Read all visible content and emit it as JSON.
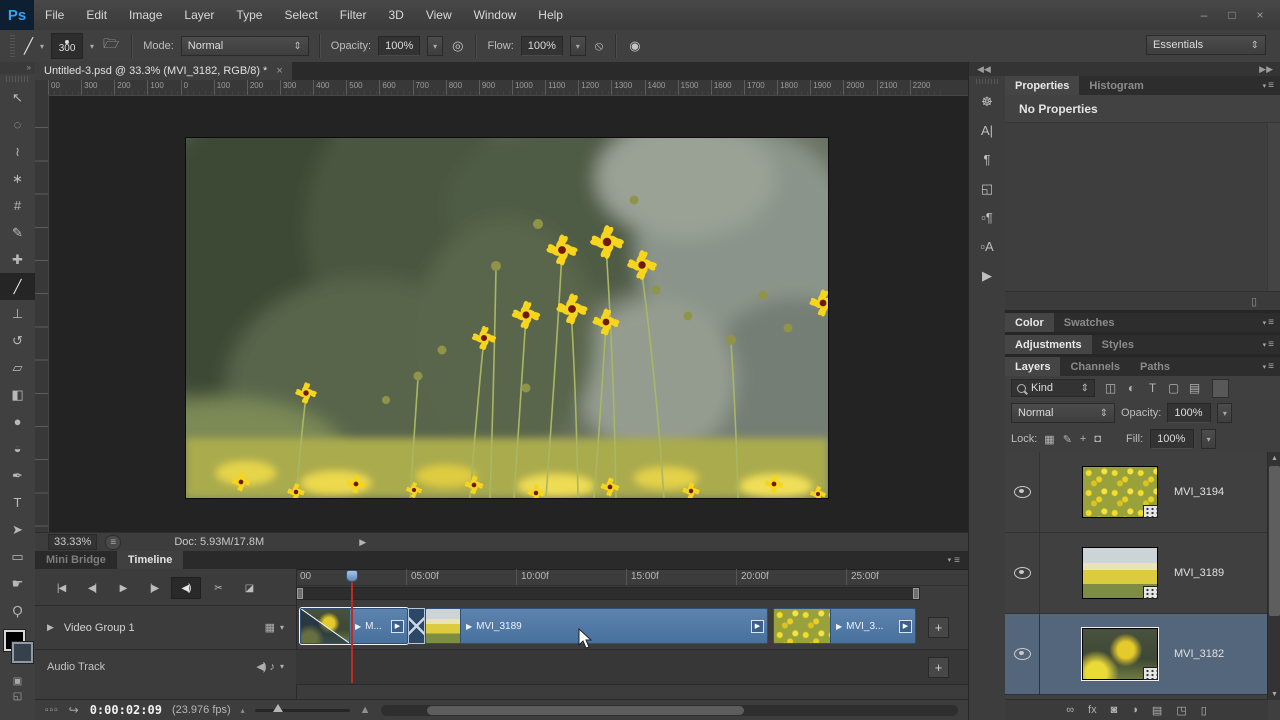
{
  "window": {
    "controls": [
      {
        "name": "minimize-button",
        "glyph": "–"
      },
      {
        "name": "maximize-button",
        "glyph": "□"
      },
      {
        "name": "close-button",
        "glyph": "×"
      }
    ]
  },
  "menu": {
    "logo": "Ps",
    "items": [
      "File",
      "Edit",
      "Image",
      "Layer",
      "Type",
      "Select",
      "Filter",
      "3D",
      "View",
      "Window",
      "Help"
    ]
  },
  "options": {
    "brush_glyph": "╱",
    "brush_size": "300",
    "mode_label": "Mode:",
    "mode_value": "Normal",
    "opacity_label": "Opacity:",
    "opacity_value": "100%",
    "flow_label": "Flow:",
    "flow_value": "100%",
    "workspace": "Essentials",
    "spinner_glyph": "⇕",
    "dropdown_glyph": "▾"
  },
  "tools": [
    {
      "name": "move-tool",
      "glyph": "↖"
    },
    {
      "name": "marquee-tool",
      "glyph": "◌"
    },
    {
      "name": "lasso-tool",
      "glyph": "≀"
    },
    {
      "name": "magic-wand-tool",
      "glyph": "∗"
    },
    {
      "name": "crop-tool",
      "glyph": "#"
    },
    {
      "name": "eyedropper-tool",
      "glyph": "✎"
    },
    {
      "name": "healing-brush-tool",
      "glyph": "✚"
    },
    {
      "name": "brush-tool",
      "glyph": "╱",
      "cls": "active"
    },
    {
      "name": "clone-stamp-tool",
      "glyph": "⊥"
    },
    {
      "name": "history-brush-tool",
      "glyph": "↺"
    },
    {
      "name": "eraser-tool",
      "glyph": "▱"
    },
    {
      "name": "gradient-tool",
      "glyph": "◧"
    },
    {
      "name": "blur-tool",
      "glyph": "●"
    },
    {
      "name": "dodge-tool",
      "glyph": "◒"
    },
    {
      "name": "pen-tool",
      "glyph": "✒"
    },
    {
      "name": "type-tool",
      "glyph": "T"
    },
    {
      "name": "path-selection-tool",
      "glyph": "➤"
    },
    {
      "name": "shape-tool",
      "glyph": "▭"
    },
    {
      "name": "hand-tool",
      "glyph": "☛"
    },
    {
      "name": "zoom-tool",
      "glyph": "Ϙ"
    }
  ],
  "toolbar_extra": {
    "quick_mask_glyph": "▣",
    "screen_mode_glyph": "◱",
    "swap_glyph": "⇄"
  },
  "document": {
    "tab_title": "Untitled-3.psd @ 33.3% (MVI_3182, RGB/8) *",
    "tab_close": "×",
    "ruler_ticks": [
      "00",
      "300",
      "200",
      "100",
      "0",
      "100",
      "200",
      "300",
      "400",
      "500",
      "600",
      "700",
      "800",
      "900",
      "1000",
      "1100",
      "1200",
      "1300",
      "1400",
      "1500",
      "1600",
      "1700",
      "1800",
      "1900",
      "2000",
      "2100",
      "2200"
    ],
    "zoom_level": "33.33%",
    "doc_size": "Doc: 5.93M/17.8M",
    "status_arrow": "▶"
  },
  "timeline": {
    "tabs": [
      {
        "label": "Mini Bridge",
        "cls": "inactive",
        "name": "tab-mini-bridge"
      },
      {
        "label": "Timeline",
        "cls": "active",
        "name": "tab-timeline"
      }
    ],
    "panel_menu_glyph": "≡",
    "transport": [
      {
        "name": "go-to-first-frame-button",
        "glyph": "|◀"
      },
      {
        "name": "previous-frame-button",
        "glyph": "◀|"
      },
      {
        "name": "play-button",
        "glyph": "▶"
      },
      {
        "name": "next-frame-button",
        "glyph": "|▶"
      },
      {
        "name": "mute-audio-button",
        "glyph": "◀)",
        "cls": "pressed"
      },
      {
        "name": "split-clip-button",
        "glyph": "✂"
      },
      {
        "name": "transition-button",
        "glyph": "◪"
      }
    ],
    "ruler": [
      "00",
      "05:00f",
      "10:00f",
      "15:00f",
      "20:00f",
      "25:00f"
    ],
    "video_group_label": "Video Group 1",
    "audio_track_label": "Audio Track",
    "clips": [
      {
        "label": "M..."
      },
      {
        "label": "MVI_3189"
      },
      {
        "label": "MVI_3..."
      }
    ],
    "add_track_glyph": "+",
    "frames_glyph": "▫▫▫",
    "render_glyph": "↪",
    "timecode": "0:00:02:09",
    "fps": "(23.976 fps)",
    "zoom_out_glyph": "▴",
    "zoom_in_glyph": "▲"
  },
  "panel_icons": [
    {
      "name": "adjustments-panel-icon",
      "glyph": "☸"
    },
    {
      "name": "character-panel-icon",
      "glyph": "A|"
    },
    {
      "name": "paragraph-panel-icon",
      "glyph": "¶"
    },
    {
      "name": "clone-source-panel-icon",
      "glyph": "◱"
    },
    {
      "name": "paragraph-styles-panel-icon",
      "glyph": "▫¶"
    },
    {
      "name": "character-styles-panel-icon",
      "glyph": "▫A"
    },
    {
      "name": "timeline-panel-icon",
      "glyph": "▶"
    }
  ],
  "panels": {
    "collapse_left": "◀◀",
    "collapse_right": "▶▶",
    "panel_menu_glyph": "≡",
    "properties": {
      "tabs": [
        {
          "label": "Properties",
          "cls": "active",
          "name": "tab-properties"
        },
        {
          "label": "Histogram",
          "cls": "dim",
          "name": "tab-histogram"
        }
      ],
      "message": "No Properties",
      "delete_glyph": "▯"
    },
    "color": {
      "tabs": [
        {
          "label": "Color",
          "cls": "active",
          "name": "tab-color"
        },
        {
          "label": "Swatches",
          "cls": "dim",
          "name": "tab-swatches"
        }
      ]
    },
    "adjustments": {
      "tabs": [
        {
          "label": "Adjustments",
          "cls": "active",
          "name": "tab-adjustments"
        },
        {
          "label": "Styles",
          "cls": "dim",
          "name": "tab-styles"
        }
      ]
    },
    "layers": {
      "tabs": [
        {
          "label": "Layers",
          "cls": "active",
          "name": "tab-layers"
        },
        {
          "label": "Channels",
          "cls": "dim",
          "name": "tab-channels"
        },
        {
          "label": "Paths",
          "cls": "dim",
          "name": "tab-paths"
        }
      ],
      "filter_value": "Kind",
      "filter_icons": [
        {
          "name": "filter-pixel-layers-icon",
          "glyph": "◫"
        },
        {
          "name": "filter-adjustment-layers-icon",
          "glyph": "◐"
        },
        {
          "name": "filter-type-layers-icon",
          "glyph": "T"
        },
        {
          "name": "filter-shape-layers-icon",
          "glyph": "▢"
        },
        {
          "name": "filter-smart-objects-icon",
          "glyph": "▤"
        }
      ],
      "blend_mode": "Normal",
      "opacity_label": "Opacity:",
      "opacity_value": "100%",
      "lock_label": "Lock:",
      "lock_icons": [
        {
          "name": "lock-transparency-icon",
          "glyph": "▦"
        },
        {
          "name": "lock-pixels-icon",
          "glyph": "✎"
        },
        {
          "name": "lock-position-icon",
          "glyph": "+"
        },
        {
          "name": "lock-all-icon",
          "glyph": "◘"
        }
      ],
      "fill_label": "Fill:",
      "fill_value": "100%",
      "items": [
        {
          "name": "MVI_3194",
          "cls": "thumb-3194"
        },
        {
          "name": "MVI_3189",
          "cls": "thumb-3189"
        },
        {
          "name": "MVI_3182",
          "cls": "thumb-3182 selected"
        }
      ],
      "footer_icons": [
        {
          "name": "link-layers-icon",
          "glyph": "∞"
        },
        {
          "name": "layer-effects-icon",
          "glyph": "fx"
        },
        {
          "name": "add-mask-icon",
          "glyph": "◙"
        },
        {
          "name": "adjustment-layer-icon",
          "glyph": "◑"
        },
        {
          "name": "new-group-icon",
          "glyph": "▤"
        },
        {
          "name": "new-layer-icon",
          "glyph": "◳"
        },
        {
          "name": "delete-layer-icon",
          "glyph": "▯"
        }
      ]
    }
  },
  "colors": {
    "ps_logo_blue": "#39a3f2",
    "clip_blue": "#50769f",
    "selected_layer_bg": "#54667c",
    "playhead_red": "#c12a21"
  }
}
